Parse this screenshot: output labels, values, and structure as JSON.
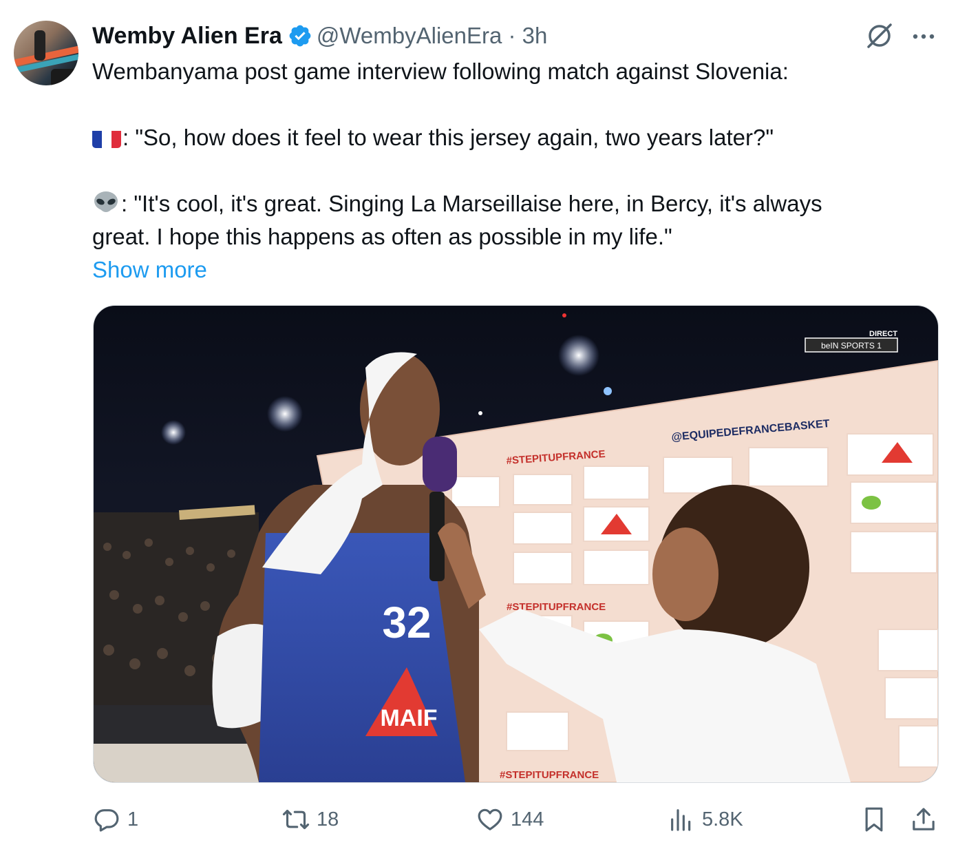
{
  "tweet": {
    "author_name": "Wemby Alien Era",
    "handle_time": "@WembyAlienEra · 3h",
    "line1": "Wembanyama post game interview following match against Slovenia:",
    "question": ": \"So, how does it feel to wear this jersey again, two years later?\"",
    "answer_line1": ": \"It's cool, it's great. Singing La Marseillaise here, in Bercy, it's always",
    "answer_line2": "great. I hope this happens as often as possible in my life.\"",
    "show_more": "Show more"
  },
  "media": {
    "broadcast_live": "DIRECT",
    "broadcast_channel": "beIN SPORTS 1",
    "wall_handle": "@EQUIPEDEFRANCEBASKET",
    "wall_hashtag": "#STEPITUPFRANCE",
    "jersey_number": "32",
    "jersey_sponsor": "MAIF"
  },
  "actions": {
    "replies": "1",
    "reposts": "18",
    "likes": "144",
    "views": "5.8K"
  },
  "colors": {
    "link": "#1d9bf0",
    "verified": "#1d9bf0",
    "muted": "#536471"
  }
}
